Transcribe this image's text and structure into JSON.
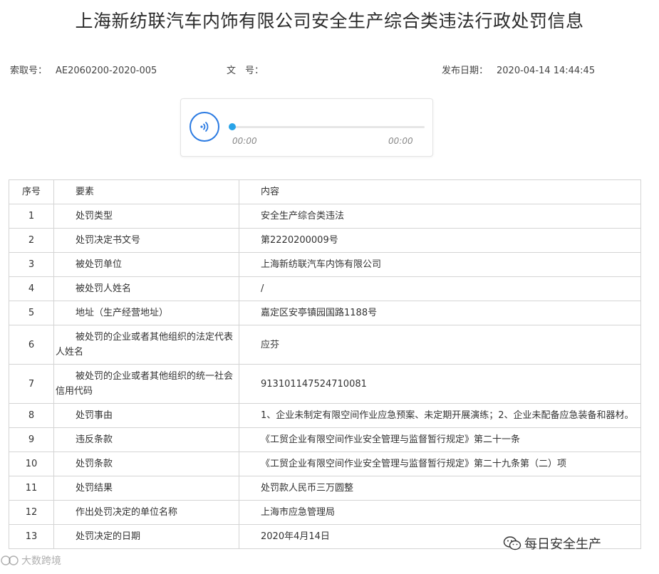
{
  "title": "上海新纺联汽车内饰有限公司安全生产综合类违法行政处罚信息",
  "meta": {
    "index_label": "索取号：",
    "index_value": "AE2060200-2020-005",
    "doc_label": "文　号：",
    "doc_value": "",
    "date_label": "发布日期：",
    "date_value": "2020-04-14 14:44:45"
  },
  "player": {
    "icon": "audio-play-icon",
    "current_time": "00:00",
    "total_time": "00:00",
    "accent": "#2a7ae2",
    "progress": 0
  },
  "table": {
    "headers": [
      "序号",
      "要素",
      "内容"
    ],
    "rows": [
      [
        "1",
        "处罚类型",
        "安全生产综合类违法"
      ],
      [
        "2",
        "处罚决定书文号",
        "第2220200009号"
      ],
      [
        "3",
        "被处罚单位",
        "上海新纺联汽车内饰有限公司"
      ],
      [
        "4",
        "被处罚人姓名",
        "/"
      ],
      [
        "5",
        "地址（生产经营地址）",
        "嘉定区安亭镇园国路1188号"
      ],
      [
        "6",
        "被处罚的企业或者其他组织的法定代表人姓名",
        "应芬"
      ],
      [
        "7",
        "被处罚的企业或者其他组织的统一社会信用代码",
        "913101147524710081"
      ],
      [
        "8",
        "处罚事由",
        "1、企业未制定有限空间作业应急预案、未定期开展演练；2、企业未配备应急装备和器材。"
      ],
      [
        "9",
        "违反条款",
        "《工贸企业有限空间作业安全管理与监督暂行规定》第二十一条"
      ],
      [
        "10",
        "处罚条款",
        "《工贸企业有限空间作业安全管理与监督暂行规定》第二十九条第（二）项"
      ],
      [
        "11",
        "处罚结果",
        "处罚款人民币三万圆整"
      ],
      [
        "12",
        "作出处罚决定的单位名称",
        "上海市应急管理局"
      ],
      [
        "13",
        "处罚决定的日期",
        "2020年4月14日"
      ]
    ]
  },
  "watermarks": {
    "wechat": "每日安全生产",
    "bottom_left": "大数跨境"
  }
}
